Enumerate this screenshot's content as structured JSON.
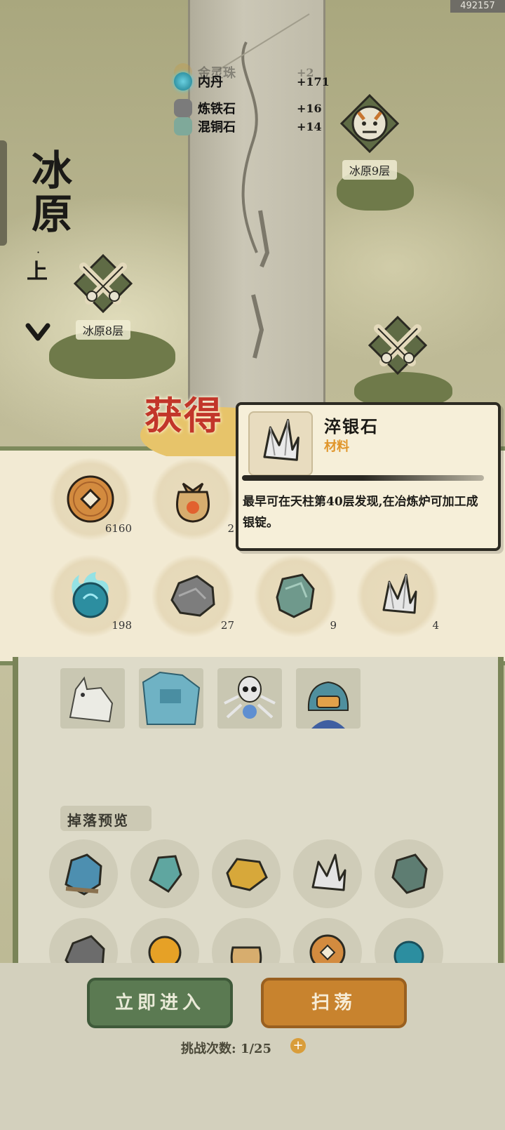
{
  "build_id": "492157",
  "zone": {
    "name": "冰原",
    "dot": "·",
    "sub": "上"
  },
  "log": [
    {
      "name": "金灵珠",
      "amount": "+2",
      "faded": true
    },
    {
      "name": "内丹",
      "amount": "+171"
    },
    {
      "name": "炼铁石",
      "amount": "+16"
    },
    {
      "name": "混铜石",
      "amount": "+14"
    }
  ],
  "stages": {
    "left": "冰原8层",
    "right": "冰原9层"
  },
  "banner": "获得",
  "rewards": [
    {
      "icon": "copper-coin-icon",
      "count": "6160"
    },
    {
      "icon": "spice-bag-icon",
      "count": "2"
    },
    {
      "icon": "spirit-orb-icon",
      "count": "198"
    },
    {
      "icon": "iron-ore-icon",
      "count": "27"
    },
    {
      "icon": "copper-ore-icon",
      "count": "9"
    },
    {
      "icon": "silver-ore-icon",
      "count": "4"
    }
  ],
  "tooltip": {
    "name": "淬银石",
    "type": "材料",
    "desc": "最早可在天柱第40层发现,在冶炼炉可加工成银锭。"
  },
  "drop_preview": {
    "title": "掉落预览"
  },
  "buttons": {
    "enter": "立即进入",
    "sweep": "扫荡"
  },
  "challenge": {
    "label": "挑战次数:",
    "value": "1/25",
    "plus": "+"
  },
  "colors": {
    "accent_green": "#5b7a52",
    "accent_orange": "#c8832e",
    "banner_red": "#c2362a",
    "type_orange": "#e0952a"
  }
}
